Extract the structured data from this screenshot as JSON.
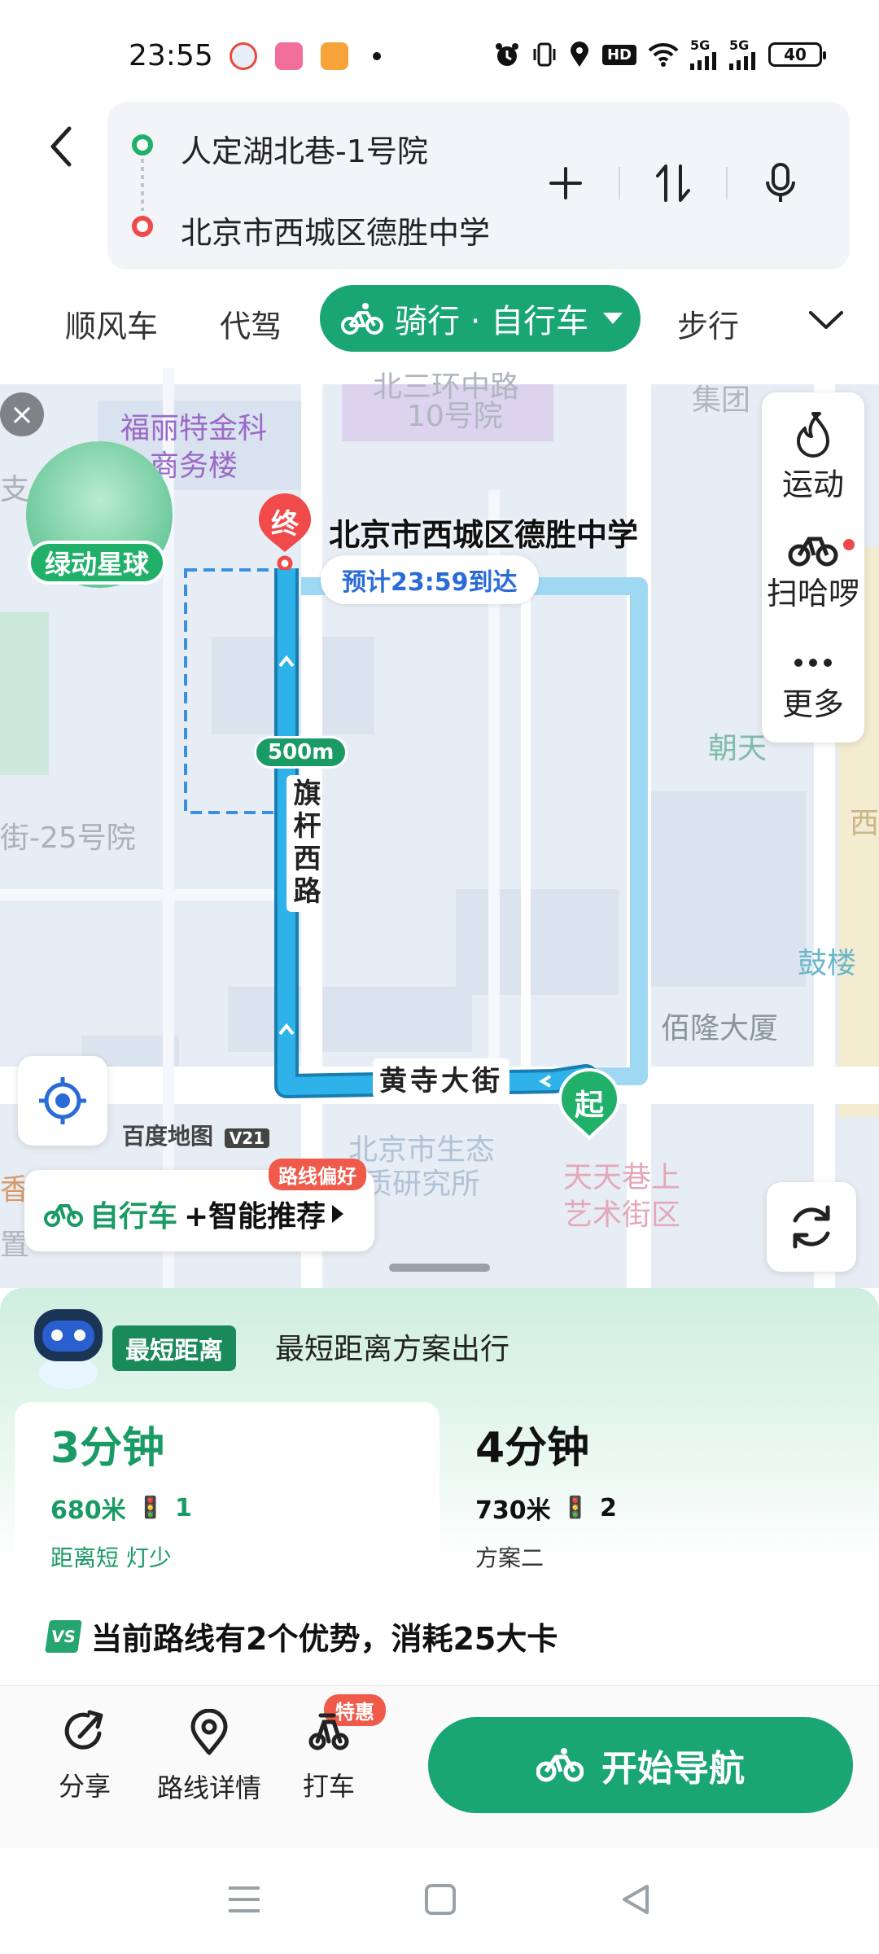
{
  "status_bar": {
    "time": "23:55",
    "battery": "40",
    "hd_label": "HD",
    "sim1_label": "5G",
    "sim2_label": "5G"
  },
  "route": {
    "start": "人定湖北巷-1号院",
    "end": "北京市西城区德胜中学"
  },
  "modes": {
    "tab1": "顺风车",
    "tab2": "代驾",
    "active": "骑行 · 自行车",
    "tab4": "步行"
  },
  "map": {
    "labels": {
      "road_top": "北三环中路",
      "building_10": "10号院",
      "fulite": "福丽特金科\n商务楼",
      "jituan": "集团",
      "jie25": "街-25号院",
      "zhi": "支",
      "chaotian": "朝天",
      "xi": "西",
      "gulou": "鼓楼",
      "bailong": "佰隆大厦",
      "eco_inst": "北京市生态\n质研究所",
      "tiantian": "天天巷上\n艺术街区",
      "xiang": "香",
      "zhi2": "置"
    },
    "planet_tag": "绿动星球",
    "side_panel": {
      "sport": "运动",
      "scan": "扫哈啰",
      "more": "更多"
    },
    "end_pin": "终",
    "start_pin": "起",
    "destination": "北京市西城区德胜中学",
    "eta": "预计23:59到达",
    "distance_chip": "500m",
    "road_vertical": "旗杆西路",
    "road_horizontal": "黄寺大街",
    "brand": "百度地图",
    "brand_version": "V21",
    "recommend": {
      "badge": "路线偏好",
      "mode": "自行车",
      "plus": "+智能推荐"
    }
  },
  "sheet": {
    "tag": "最短距离",
    "desc": "最短距离方案出行",
    "plans": [
      {
        "time": "3分钟",
        "distance": "680米",
        "lights": "1",
        "sub": "距离短 灯少"
      },
      {
        "time": "4分钟",
        "distance": "730米",
        "lights": "2",
        "sub": "方案二"
      }
    ],
    "advantages": "当前路线有2个优势，消耗25大卡"
  },
  "actions": {
    "share": "分享",
    "details": "路线详情",
    "taxi": "打车",
    "promo": "特惠",
    "navigate": "开始导航"
  },
  "colors": {
    "primary": "#1aa574",
    "route_blue": "#2fb1ea",
    "route_light": "#9fd8f3",
    "danger": "#f04a4a"
  }
}
